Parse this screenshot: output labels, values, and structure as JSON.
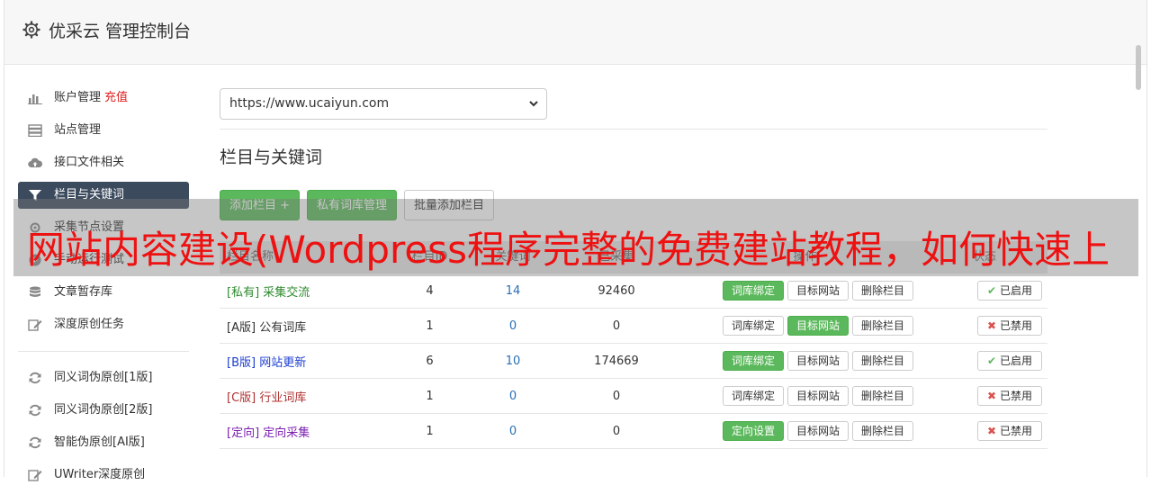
{
  "header": {
    "title": "优采云 管理控制台"
  },
  "sidebar": {
    "items": [
      {
        "label": "账户管理",
        "extra": "充值",
        "icon": "bar-chart-icon"
      },
      {
        "label": "站点管理",
        "icon": "server-icon"
      },
      {
        "label": "接口文件相关",
        "icon": "cloud-upload-icon"
      },
      {
        "label": "栏目与关键词",
        "icon": "filter-icon",
        "active": true
      },
      {
        "label": "采集节点设置",
        "icon": "gear-icon"
      },
      {
        "label": "手动运行测试",
        "icon": "play-icon"
      },
      {
        "label": "文章暂存库",
        "icon": "database-icon"
      },
      {
        "label": "深度原创任务",
        "icon": "edit-icon"
      }
    ],
    "items2": [
      {
        "label": "同义词伪原创[1版]",
        "icon": "refresh-icon"
      },
      {
        "label": "同义词伪原创[2版]",
        "icon": "refresh-icon"
      },
      {
        "label": "智能伪原创[AI版]",
        "icon": "refresh-icon"
      },
      {
        "label": "UWriter深度原创",
        "icon": "edit-icon"
      }
    ]
  },
  "main": {
    "site_select": "https://www.ucaiyun.com",
    "section_title": "栏目与关键词",
    "add_column": "添加栏目 +",
    "private_lib": "私有词库管理",
    "batch_add": "批量添加栏目"
  },
  "table": {
    "headers": [
      "栏目名称",
      "栏目ID",
      "关键词",
      "已采集",
      "操作",
      "状态"
    ],
    "rows": [
      {
        "tag": "[私有]",
        "name": "采集交流",
        "color": "#2e8b2e",
        "id": "4",
        "keywords": "14",
        "collected": "92460",
        "bind": "词库绑定",
        "bind_green": true,
        "target": "目标网站",
        "target_green": false,
        "del": "删除栏目",
        "status": "已启用",
        "enabled": true
      },
      {
        "tag": "[A版]",
        "name": "公有词库",
        "color": "#333333",
        "id": "1",
        "keywords": "0",
        "collected": "0",
        "bind": "词库绑定",
        "bind_green": false,
        "target": "目标网站",
        "target_green": true,
        "del": "删除栏目",
        "status": "已禁用",
        "enabled": false
      },
      {
        "tag": "[B版]",
        "name": "网站更新",
        "color": "#1e3fcf",
        "id": "6",
        "keywords": "10",
        "collected": "174669",
        "bind": "词库绑定",
        "bind_green": true,
        "target": "目标网站",
        "target_green": false,
        "del": "删除栏目",
        "status": "已启用",
        "enabled": true
      },
      {
        "tag": "[C版]",
        "name": "行业词库",
        "color": "#b03030",
        "id": "1",
        "keywords": "0",
        "collected": "0",
        "bind": "词库绑定",
        "bind_green": false,
        "target": "目标网站",
        "target_green": false,
        "del": "删除栏目",
        "status": "已禁用",
        "enabled": false
      },
      {
        "tag": "[定向]",
        "name": "定向采集",
        "color": "#7a1fb0",
        "id": "1",
        "keywords": "0",
        "collected": "0",
        "bind": "定向设置",
        "bind_green": true,
        "target": "目标网站",
        "target_green": false,
        "del": "删除栏目",
        "status": "已禁用",
        "enabled": false
      }
    ]
  },
  "overlay": {
    "text": "网站内容建设(Wordpress程序完整的免费建站教程，如何快速上"
  }
}
